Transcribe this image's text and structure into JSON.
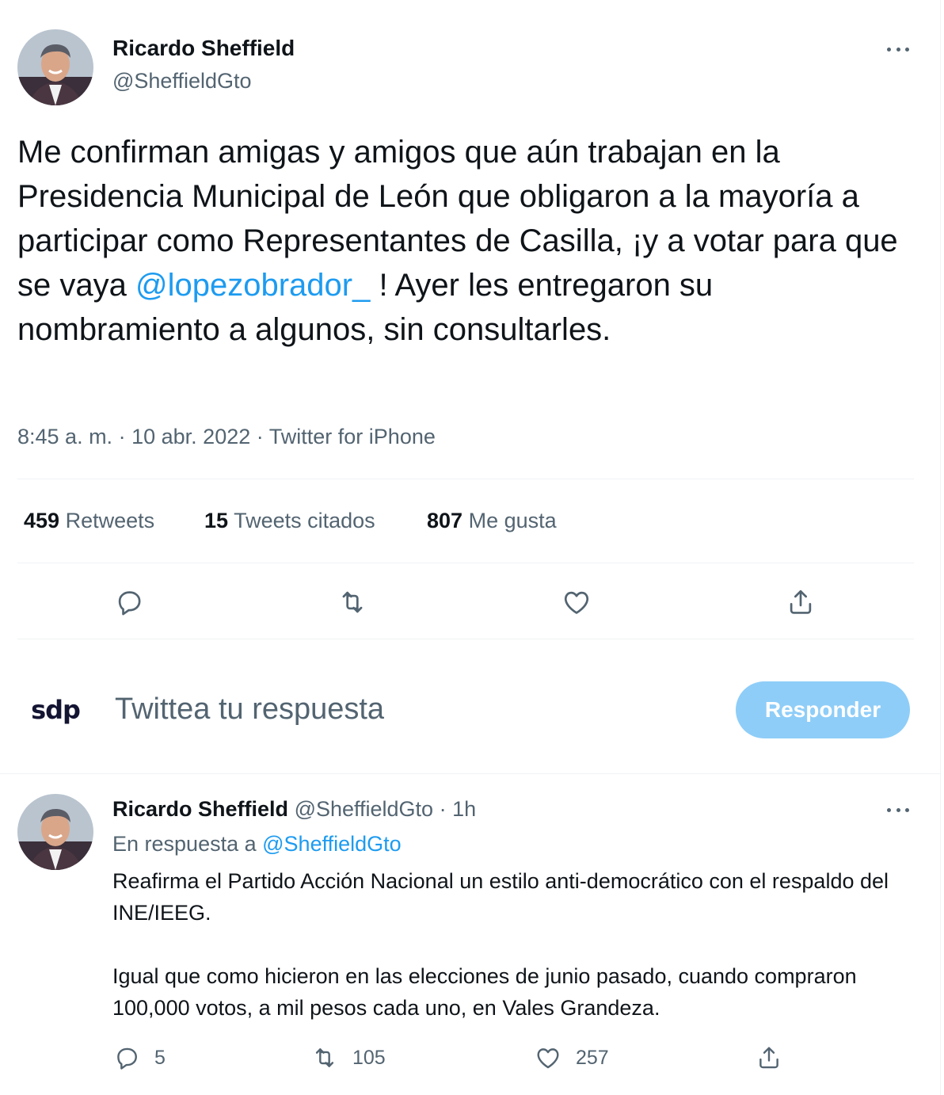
{
  "main_tweet": {
    "author_name": "Ricardo Sheffield",
    "author_handle": "@SheffieldGto",
    "text_before_mention": "Me confirman amigas y amigos que aún trabajan en la Presidencia Municipal de León que obligaron a la mayoría a participar como Representantes de Casilla, ¡y a votar para que se vaya ",
    "mention": "@lopezobrador_",
    "text_after_mention": " ! Ayer les entregaron su nombramiento a algunos, sin consultarles.",
    "time": "8:45 a. m.",
    "separator": "·",
    "date": "10 abr. 2022",
    "source": "Twitter for iPhone",
    "stats": {
      "retweets_count": "459",
      "retweets_label": "Retweets",
      "quotes_count": "15",
      "quotes_label": "Tweets citados",
      "likes_count": "807",
      "likes_label": "Me gusta"
    }
  },
  "reply_composer": {
    "avatar_text": "sdp",
    "placeholder": "Twittea tu respuesta",
    "button_label": "Responder",
    "button_color": "#8ecdf8"
  },
  "reply_tweet": {
    "author_name": "Ricardo Sheffield",
    "author_handle": "@SheffieldGto",
    "separator": "·",
    "time_ago": "1h",
    "in_reply_prefix": "En respuesta a",
    "in_reply_handle": "@SheffieldGto",
    "paragraph_1": "Reafirma el Partido Acción Nacional un estilo anti-democrático con el respaldo del INE/IEEG.",
    "paragraph_2": "Igual que como hicieron en las elecciones de junio pasado, cuando compraron 100,000 votos, a mil pesos cada uno, en Vales Grandeza.",
    "reply_count": "5",
    "retweet_count": "105",
    "like_count": "257"
  },
  "colors": {
    "link": "#1d9bf0",
    "muted": "#536471",
    "divider": "#eff3f4"
  }
}
